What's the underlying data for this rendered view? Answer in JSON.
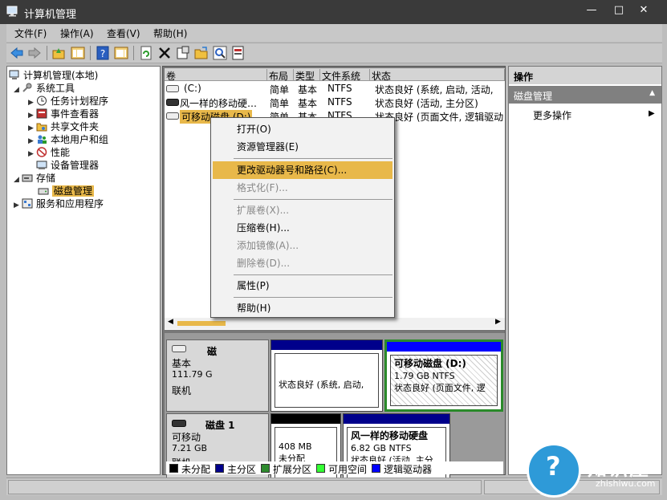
{
  "window": {
    "title": "计算机管理",
    "minimize": "—",
    "maximize": "□",
    "close": "✕"
  },
  "menubar": [
    "文件(F)",
    "操作(A)",
    "查看(V)",
    "帮助(H)"
  ],
  "toolbar_icons": [
    "back-icon",
    "forward-icon",
    "up-icon",
    "show-hide-tree-icon",
    "help-icon",
    "properties-view-icon",
    "refresh-icon",
    "delete-icon",
    "properties-icon",
    "open-icon",
    "search-icon",
    "help-topic-icon"
  ],
  "tree": {
    "root": "计算机管理(本地)",
    "system_tools": "系统工具",
    "task_scheduler": "任务计划程序",
    "event_viewer": "事件查看器",
    "shared_folders": "共享文件夹",
    "local_users": "本地用户和组",
    "performance": "性能",
    "device_manager": "设备管理器",
    "storage": "存储",
    "disk_management": "磁盘管理",
    "services_apps": "服务和应用程序"
  },
  "volumes": {
    "headers": [
      "卷",
      "布局",
      "类型",
      "文件系统",
      "状态"
    ],
    "rows": [
      {
        "name": "(C:)",
        "layout": "简单",
        "type": "基本",
        "fs": "NTFS",
        "status": "状态良好 (系统, 启动, 活动,"
      },
      {
        "name": "风一样的移动硬…",
        "layout": "简单",
        "type": "基本",
        "fs": "NTFS",
        "status": "状态良好 (活动, 主分区)"
      },
      {
        "name": "可移动磁盘 (D:)",
        "layout": "简单",
        "type": "基本",
        "fs": "NTFS",
        "status": "状态良好 (页面文件, 逻辑驱动"
      }
    ]
  },
  "disks": [
    {
      "name": "磁",
      "type": "基本",
      "size": "111.79 G",
      "state": "联机",
      "partitions": [
        {
          "size": "",
          "status": "状态良好 (系统, 启动,"
        },
        {
          "name": "可移动磁盘 (D:)",
          "size": "1.79 GB NTFS",
          "status": "状态良好 (页面文件, 逻"
        }
      ]
    },
    {
      "name": "磁盘 1",
      "type": "可移动",
      "size": "7.21 GB",
      "state": "联机",
      "partitions": [
        {
          "size": "408 MB",
          "status": "未分配"
        },
        {
          "name": "风一样的移动硬盘",
          "size": "6.82 GB NTFS",
          "status": "状态良好 (活动, 主分"
        }
      ]
    }
  ],
  "legend": [
    {
      "label": "未分配",
      "color": "#000000"
    },
    {
      "label": "主分区",
      "color": "#00008b"
    },
    {
      "label": "扩展分区",
      "color": "#2e8b2e"
    },
    {
      "label": "可用空间",
      "color": "#33ff33"
    },
    {
      "label": "逻辑驱动器",
      "color": "#0000ff"
    }
  ],
  "actions": {
    "header": "操作",
    "section": "磁盘管理",
    "more": "更多操作"
  },
  "context_menu": {
    "open": "打开(O)",
    "explorer": "资源管理器(E)",
    "change_letter": "更改驱动器号和路径(C)...",
    "format": "格式化(F)...",
    "extend": "扩展卷(X)...",
    "shrink": "压缩卷(H)...",
    "add_mirror": "添加镜像(A)...",
    "delete": "删除卷(D)...",
    "properties": "属性(P)",
    "help": "帮助(H)"
  },
  "watermark": {
    "cn": "知识屋",
    "en": "zhishiwu.com"
  },
  "colors": {
    "highlight": "#e8b84a",
    "primary_partition": "#00008b",
    "logical_drive": "#0000ff",
    "unallocated": "#000000"
  }
}
